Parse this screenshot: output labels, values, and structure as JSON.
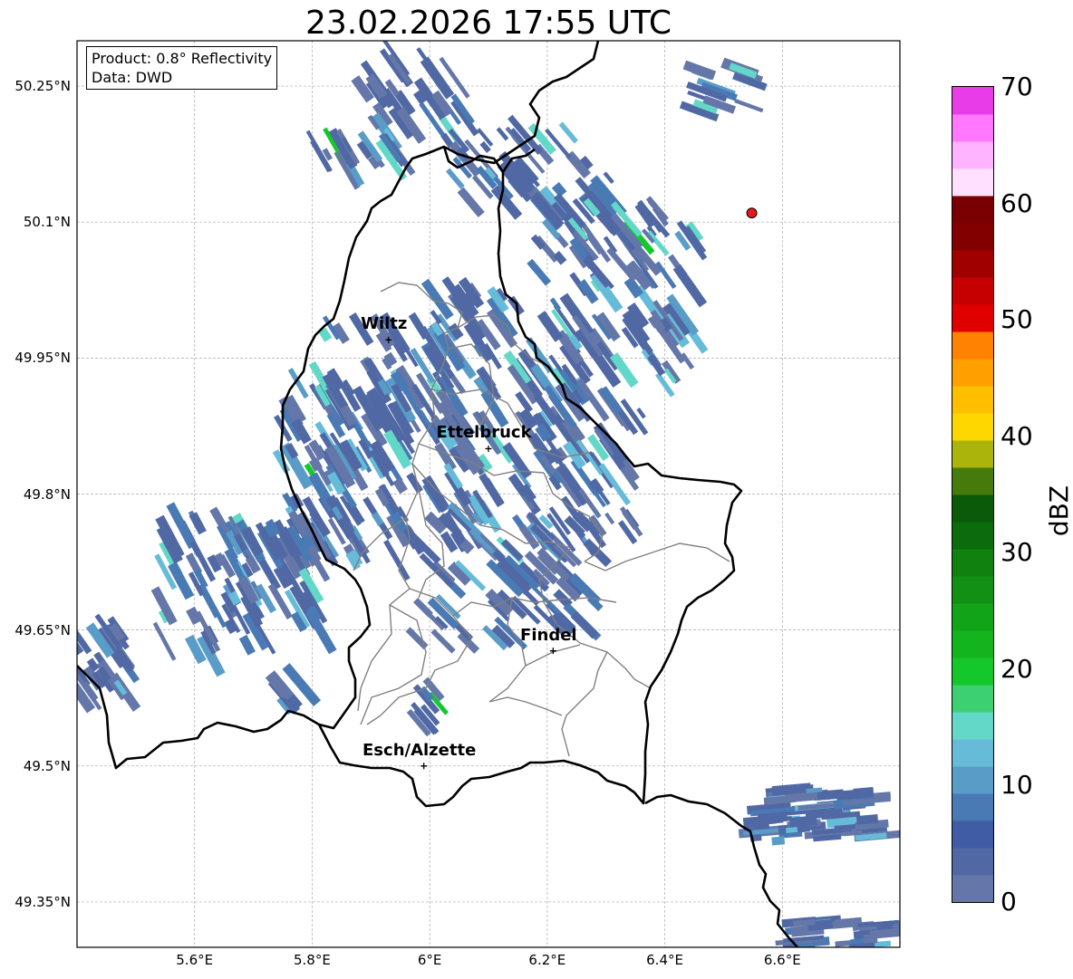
{
  "title": "23.02.2026 17:55 UTC",
  "product_box": {
    "line1": "Product: 0.8° Reflectivity",
    "line2": "Data: DWD"
  },
  "map": {
    "lon_range": [
      5.4,
      6.8
    ],
    "lat_range": [
      49.3,
      50.3
    ],
    "grid": true,
    "lat_ticks": [
      {
        "value": 50.25,
        "label": "50.25°N"
      },
      {
        "value": 50.1,
        "label": "50.1°N"
      },
      {
        "value": 49.95,
        "label": "49.95°N"
      },
      {
        "value": 49.8,
        "label": "49.8°N"
      },
      {
        "value": 49.65,
        "label": "49.65°N"
      },
      {
        "value": 49.5,
        "label": "49.5°N"
      },
      {
        "value": 49.35,
        "label": "49.35°N"
      }
    ],
    "lon_ticks": [
      {
        "value": 5.6,
        "label": "5.6°E"
      },
      {
        "value": 5.8,
        "label": "5.8°E"
      },
      {
        "value": 6.0,
        "label": "6°E"
      },
      {
        "value": 6.2,
        "label": "6.2°E"
      },
      {
        "value": 6.4,
        "label": "6.4°E"
      },
      {
        "value": 6.6,
        "label": "6.6°E"
      }
    ],
    "cities": [
      {
        "name": "Wiltz",
        "lon": 5.93,
        "lat": 49.97
      },
      {
        "name": "Ettelbruck",
        "lon": 6.1,
        "lat": 49.85
      },
      {
        "name": "Findel",
        "lon": 6.21,
        "lat": 49.627
      },
      {
        "name": "Esch/Alzette",
        "lon": 5.99,
        "lat": 49.5
      }
    ],
    "radar_site": {
      "lon": 6.548,
      "lat": 50.11,
      "color": "#e41a1c"
    },
    "border_color": "#000000",
    "canton_color": "#808080"
  },
  "colorbar": {
    "label": "dBZ",
    "min": 0,
    "max": 70,
    "ticks": [
      "70",
      "60",
      "50",
      "40",
      "30",
      "20",
      "10",
      "0"
    ],
    "colors": [
      "#6477a8",
      "#5068a4",
      "#405ca4",
      "#4a7ab4",
      "#5a9cc8",
      "#66bcd8",
      "#64d8c8",
      "#3cd070",
      "#14c82c",
      "#14b41e",
      "#12a418",
      "#129014",
      "#10800f",
      "#0b6c0b",
      "#0a5a0a",
      "#467a0a",
      "#aab40a",
      "#ffd700",
      "#ffbe00",
      "#ffa000",
      "#ff8200",
      "#e00000",
      "#c60000",
      "#a00000",
      "#820000",
      "#780000",
      "#ffe0ff",
      "#ffb4ff",
      "#ff78ff",
      "#e83ce8"
    ]
  }
}
